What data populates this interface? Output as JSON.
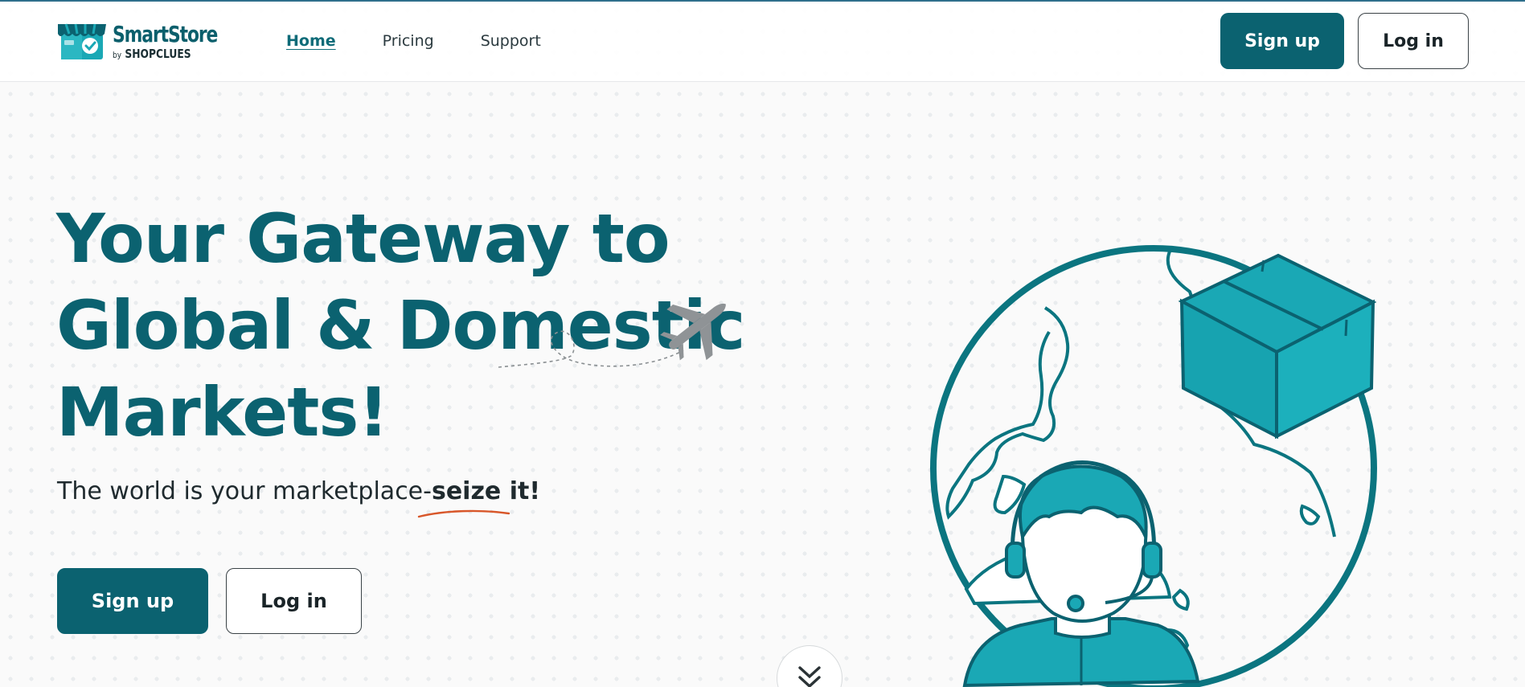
{
  "brand": {
    "name": "SmartStore",
    "by": "by",
    "sub": "SHOPCLUES",
    "colors": {
      "primary": "#0b6270",
      "accent": "#1aa8b5",
      "underline": "#d8572a"
    }
  },
  "nav": {
    "items": [
      {
        "label": "Home",
        "active": true
      },
      {
        "label": "Pricing",
        "active": false
      },
      {
        "label": "Support",
        "active": false
      }
    ]
  },
  "header_actions": {
    "signup_label": "Sign up",
    "login_label": "Log in"
  },
  "hero": {
    "title_lines": [
      "Your Gateway to",
      "Global & Domestic",
      "Markets!"
    ],
    "tagline_prefix": "The world is your marketplace-",
    "tagline_emphasis": "seize it!",
    "signup_label": "Sign up",
    "login_label": "Log in"
  },
  "icons": {
    "logo": "storefront-check-icon",
    "plane": "airplane-icon",
    "scroll": "double-chevron-down-icon",
    "illustration": "globe-support-agent-package-illustration"
  }
}
